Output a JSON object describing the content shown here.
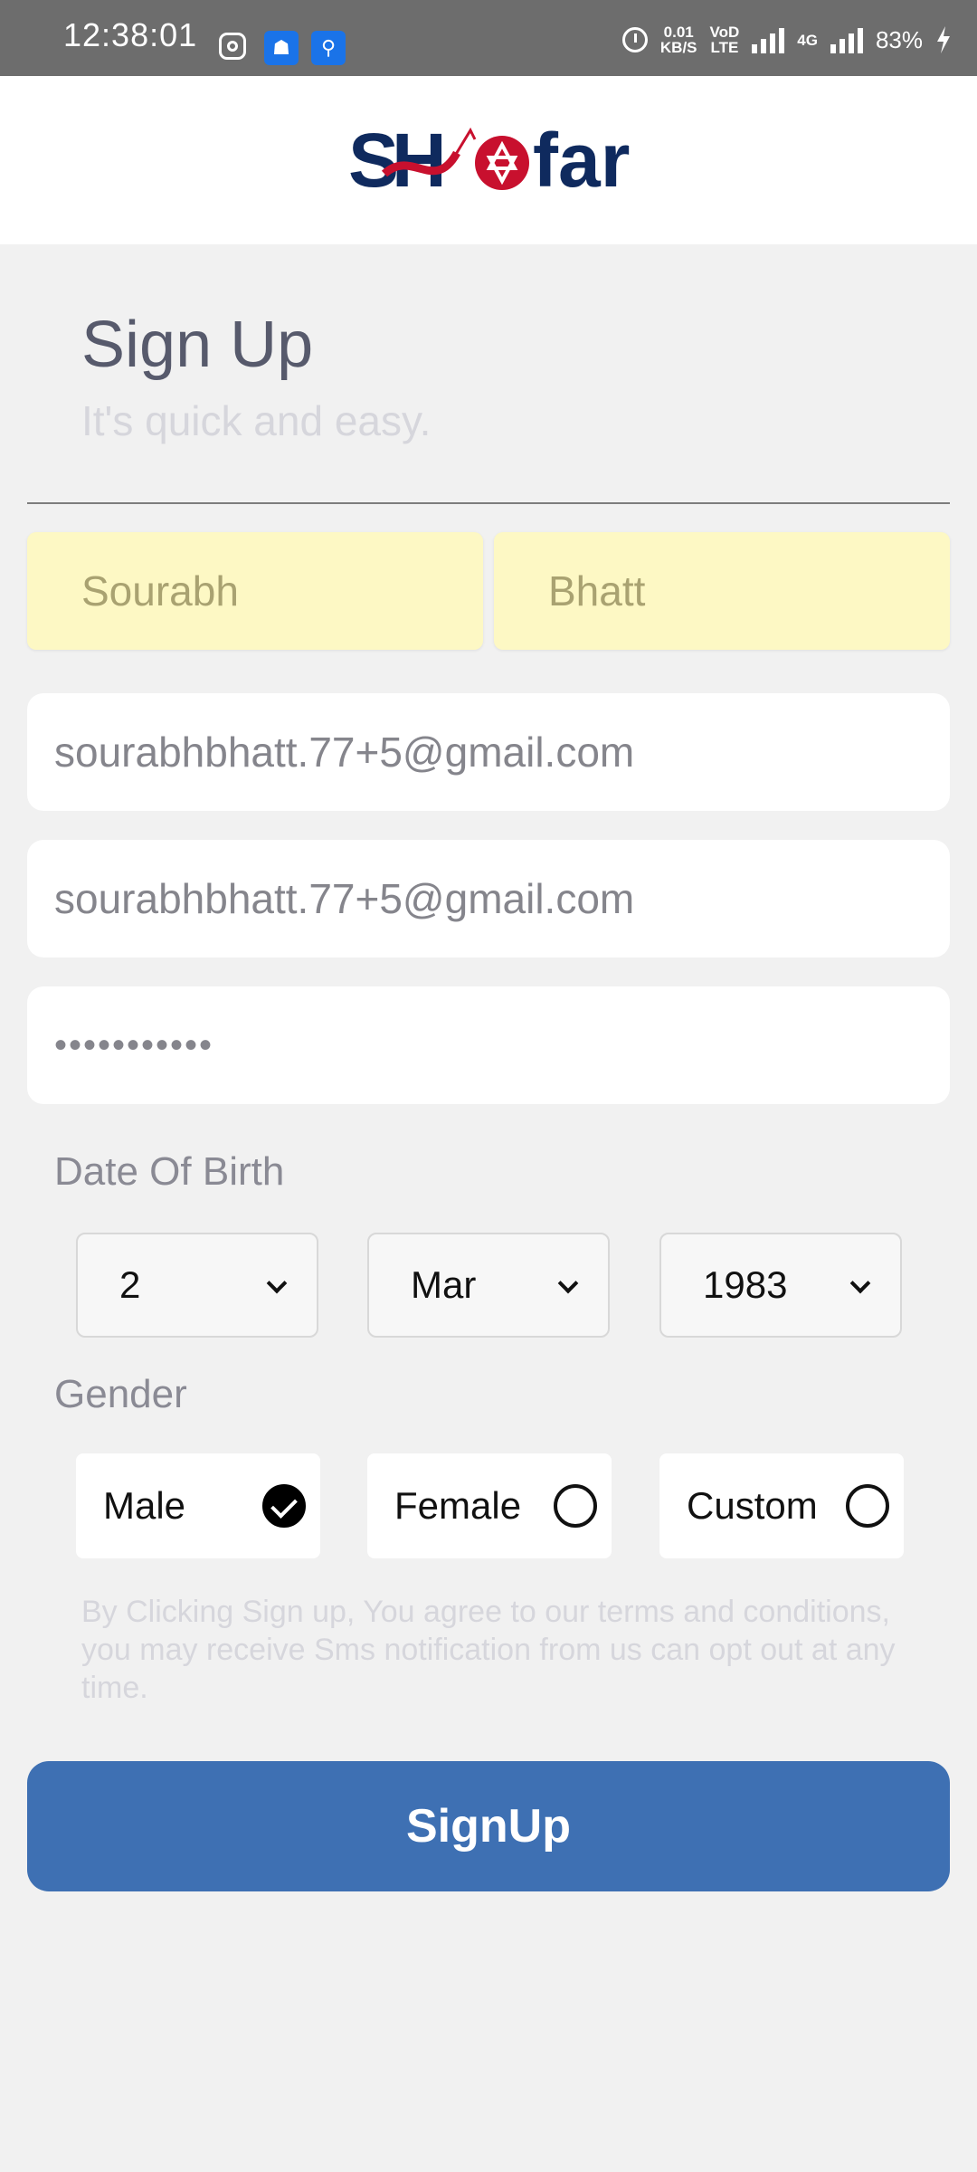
{
  "status_bar": {
    "time": "12:38:01",
    "speed_value": "0.01",
    "speed_unit": "KB/S",
    "volte_top": "VoD",
    "volte_bottom": "LTE",
    "network": "4G",
    "battery": "83%",
    "icons": [
      "instagram-icon",
      "android-icon",
      "usb-icon",
      "alarm-icon",
      "signal-icon",
      "battery-charging-icon"
    ]
  },
  "header": {
    "logo_text": "Shofar"
  },
  "form": {
    "title": "Sign Up",
    "subtitle": "It's quick and easy.",
    "first_name": "Sourabh",
    "last_name": "Bhatt",
    "email": "sourabhbhatt.77+5@gmail.com",
    "email_confirm": "sourabhbhatt.77+5@gmail.com",
    "password_mask": "•••••••••••",
    "dob_label": "Date Of Birth",
    "dob": {
      "day": "2",
      "month": "Mar",
      "year": "1983"
    },
    "gender_label": "Gender",
    "gender_options": [
      {
        "label": "Male",
        "selected": true
      },
      {
        "label": "Female",
        "selected": false
      },
      {
        "label": "Custom",
        "selected": false
      }
    ],
    "terms": "By Clicking Sign up, You agree to our terms and conditions, you may receive Sms notification from us can opt out at any time.",
    "submit_label": "SignUp"
  },
  "colors": {
    "primary": "#3e70b3",
    "logo_navy": "#0f2a5e",
    "logo_red": "#c8102e",
    "autofill": "#fdf8c4"
  }
}
